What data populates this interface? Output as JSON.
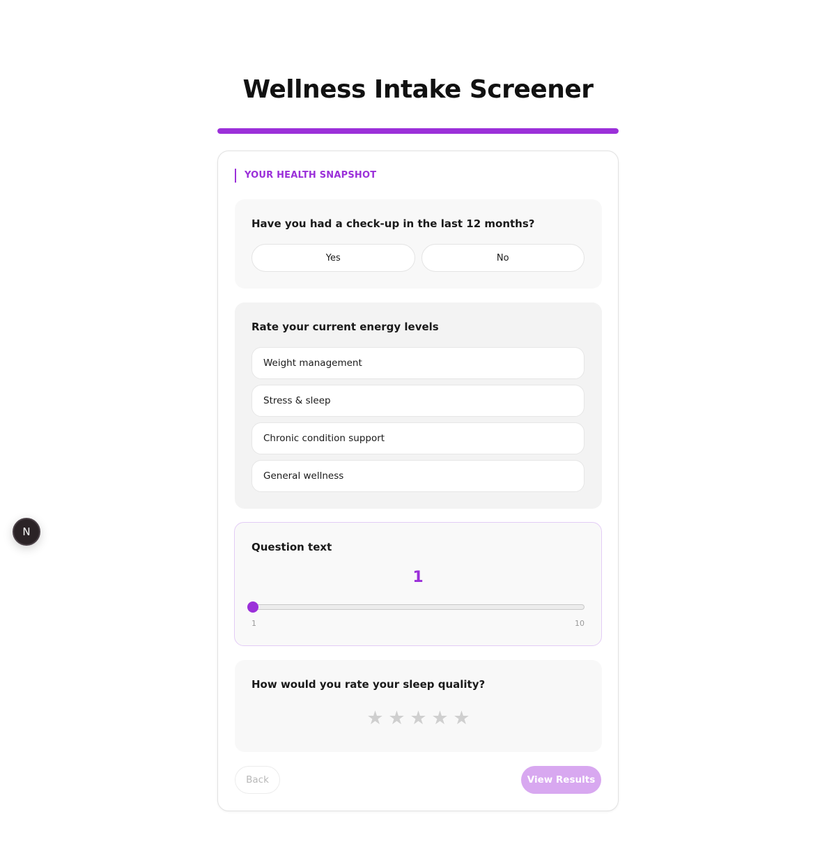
{
  "page": {
    "title": "Wellness Intake Screener",
    "accent_color": "#9b30d9",
    "progress_fraction": 1.0
  },
  "form": {
    "section_title": "YOUR HEALTH SNAPSHOT",
    "checkup": {
      "question": "Have you had a check-up in the last 12 months?",
      "options": [
        "Yes",
        "No"
      ]
    },
    "energy": {
      "question": "Rate your current energy levels",
      "options": [
        "Weight management",
        "Stress & sleep",
        "Chronic condition support",
        "General wellness"
      ]
    },
    "scale": {
      "question": "Question text",
      "value": "1",
      "min_label": "1",
      "max_label": "10",
      "min": 1,
      "max": 10
    },
    "sleep": {
      "question": "How would you rate your sleep quality?",
      "star_glyph": "★",
      "star_count": 5,
      "rating": 0
    },
    "back_label": "Back",
    "results_label": "View Results"
  },
  "dev_badge": {
    "letter": "N"
  }
}
